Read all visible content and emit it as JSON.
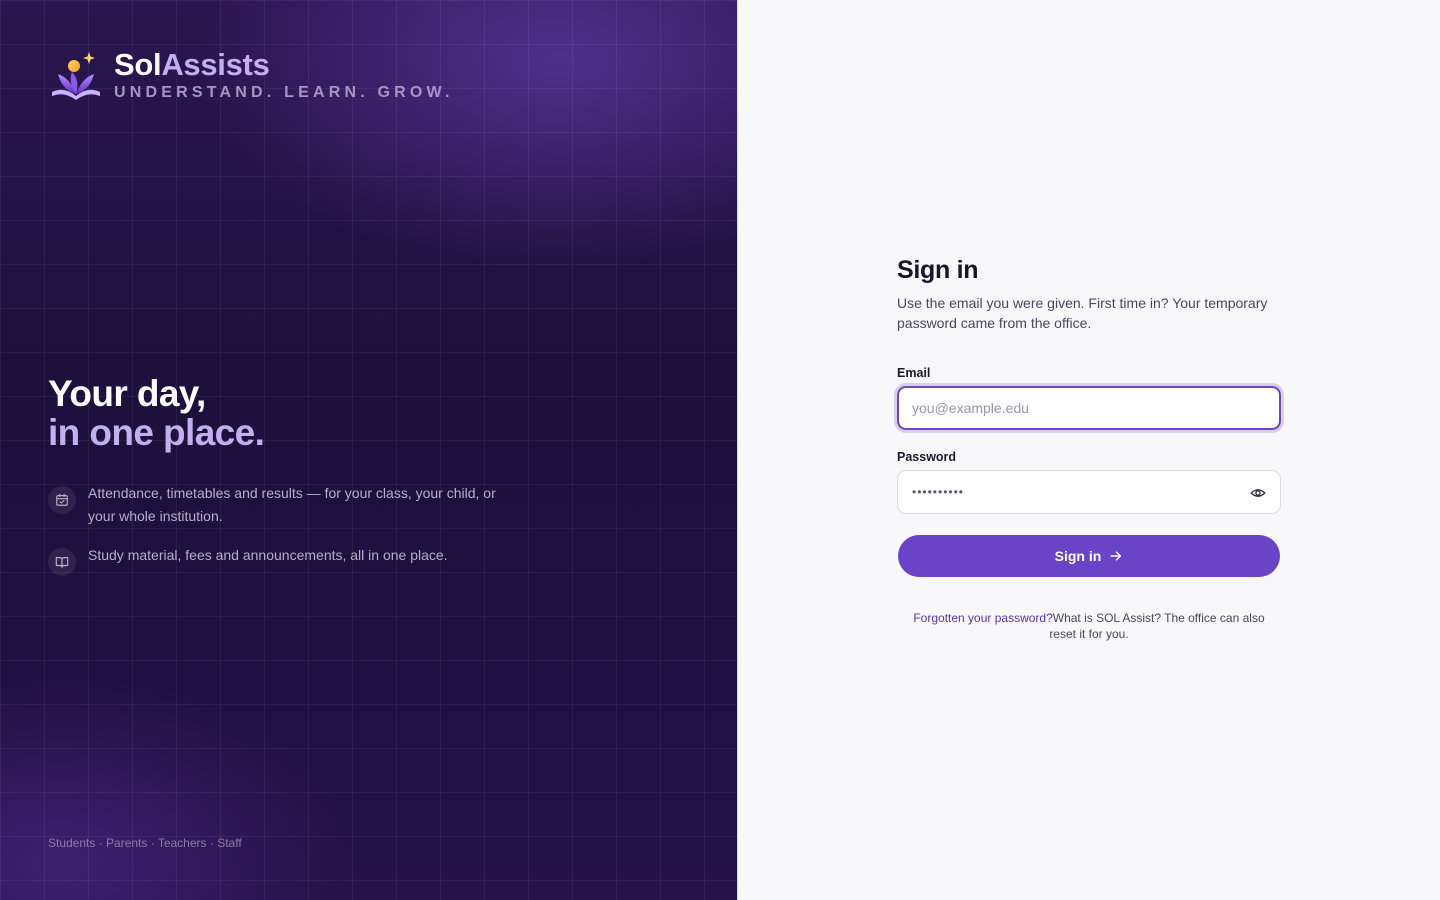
{
  "brand": {
    "name_part1": "Sol",
    "name_part2": "Assists",
    "tagline": "UNDERSTAND. LEARN. GROW."
  },
  "hero": {
    "line1": "Your day,",
    "line2": "in one place."
  },
  "features": [
    {
      "icon": "calendar-check-icon",
      "text": "Attendance, timetables and results — for your class, your child, or your whole institution."
    },
    {
      "icon": "book-open-icon",
      "text": "Study material, fees and announcements, all in one place."
    }
  ],
  "audience": "Students · Parents · Teachers · Staff",
  "form": {
    "title": "Sign in",
    "subtitle": "Use the email you were given. First time in? Your temporary password came from the office.",
    "email_label": "Email",
    "email_placeholder": "you@example.edu",
    "password_label": "Password",
    "password_value": "••••••••••",
    "submit_label": "Sign in",
    "forgot_link": "Forgotten your password?",
    "help_text": "What is SOL Assist? The office can also reset it for you."
  },
  "colors": {
    "accent": "#6b43c6",
    "panel_dark": "#1e103c",
    "brand_light": "#c4aef0"
  }
}
